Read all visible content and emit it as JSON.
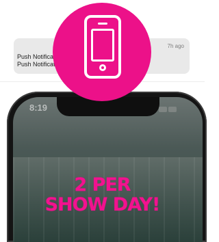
{
  "status": {
    "time": "8:19"
  },
  "notification": {
    "time": "7h ago",
    "title": "Push Notifications",
    "text": "Push Notification text goes here"
  },
  "headline": {
    "line1": "2 PER",
    "line2": "SHOW DAY!"
  },
  "colors": {
    "accent": "#ec1189",
    "notification_bg": "#e9e9e9"
  },
  "icons": {
    "badge": "smartphone-icon"
  }
}
